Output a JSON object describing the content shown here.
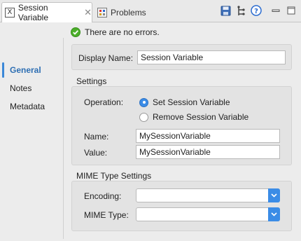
{
  "tabs": [
    {
      "label": "Session Variable",
      "icon": "session-variable-icon",
      "active": true
    },
    {
      "label": "Problems",
      "icon": "problems-icon",
      "active": false
    }
  ],
  "toolbar": {
    "icons": [
      "save-icon",
      "tree-icon",
      "help-icon",
      "minimize-icon",
      "maximize-icon"
    ]
  },
  "status": {
    "text": "There are no errors.",
    "icon": "check-circle-icon",
    "color": "#4caf2a"
  },
  "nav": {
    "items": [
      "General",
      "Notes",
      "Metadata"
    ],
    "selected": "General",
    "accent": "#2e6fb3"
  },
  "display": {
    "label": "Display Name:",
    "value": "Session Variable"
  },
  "settings": {
    "title": "Settings",
    "operation_label": "Operation:",
    "options": [
      "Set Session Variable",
      "Remove Session Variable"
    ],
    "selected_option": "Set Session Variable",
    "name_label": "Name:",
    "name_value": "MySessionVariable",
    "value_label": "Value:",
    "value_value": "MySessionVariable"
  },
  "mime": {
    "title": "MIME Type Settings",
    "encoding_label": "Encoding:",
    "encoding_value": "",
    "mime_type_label": "MIME Type:",
    "mime_type_value": ""
  }
}
